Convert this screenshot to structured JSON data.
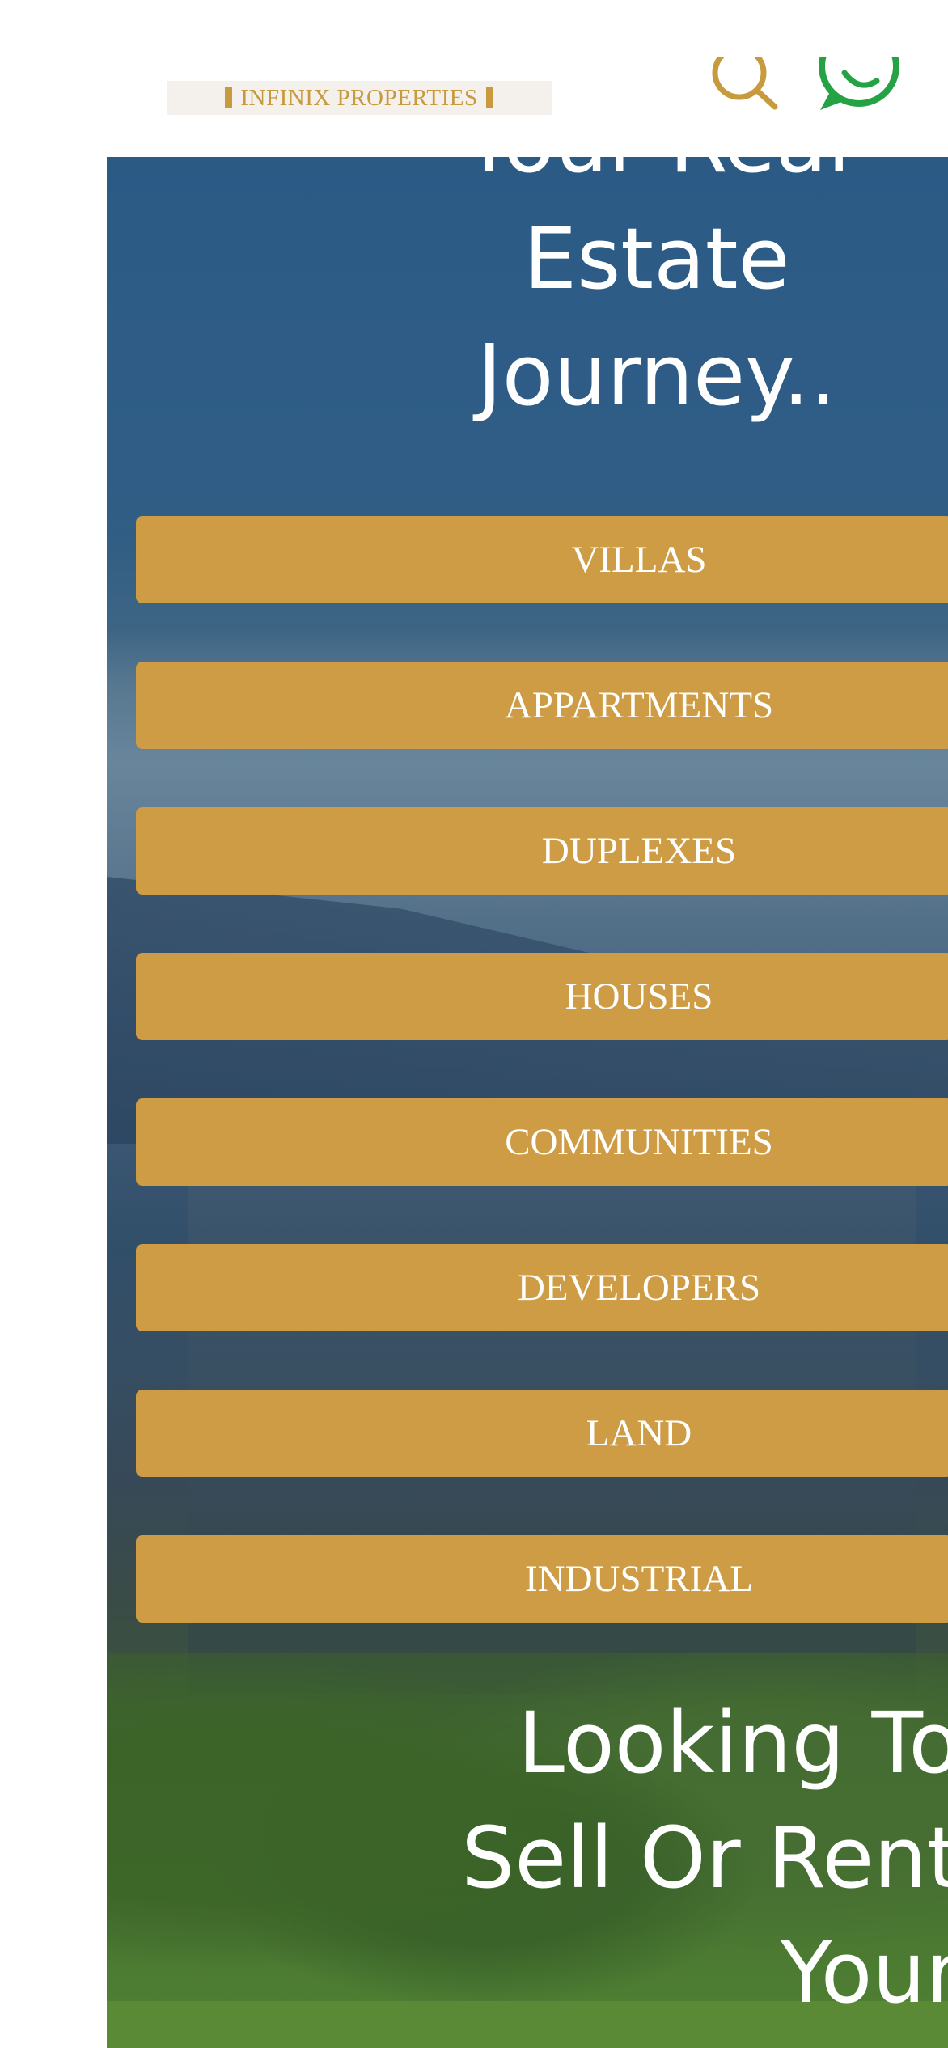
{
  "header": {
    "logo_text": "INFINIX PROPERTIES",
    "search_icon": "search-icon",
    "whatsapp_icon": "whatsapp-icon"
  },
  "hero": {
    "heading_lines": [
      "Your Real",
      "Estate",
      "Journey.."
    ],
    "categories": [
      "VILLAS",
      "APPARTMENTS",
      "DUPLEXES",
      "HOUSES",
      "COMMUNITIES",
      "DEVELOPERS",
      "LAND",
      "INDUSTRIAL"
    ],
    "sell_heading_lines": [
      "Looking To",
      "Sell Or Rent",
      "Your"
    ]
  },
  "colors": {
    "accent_gold": "#cd9c45",
    "logo_gold": "#c89a3e",
    "whatsapp_green": "#25a244",
    "hero_blue": "#2b5a85"
  }
}
